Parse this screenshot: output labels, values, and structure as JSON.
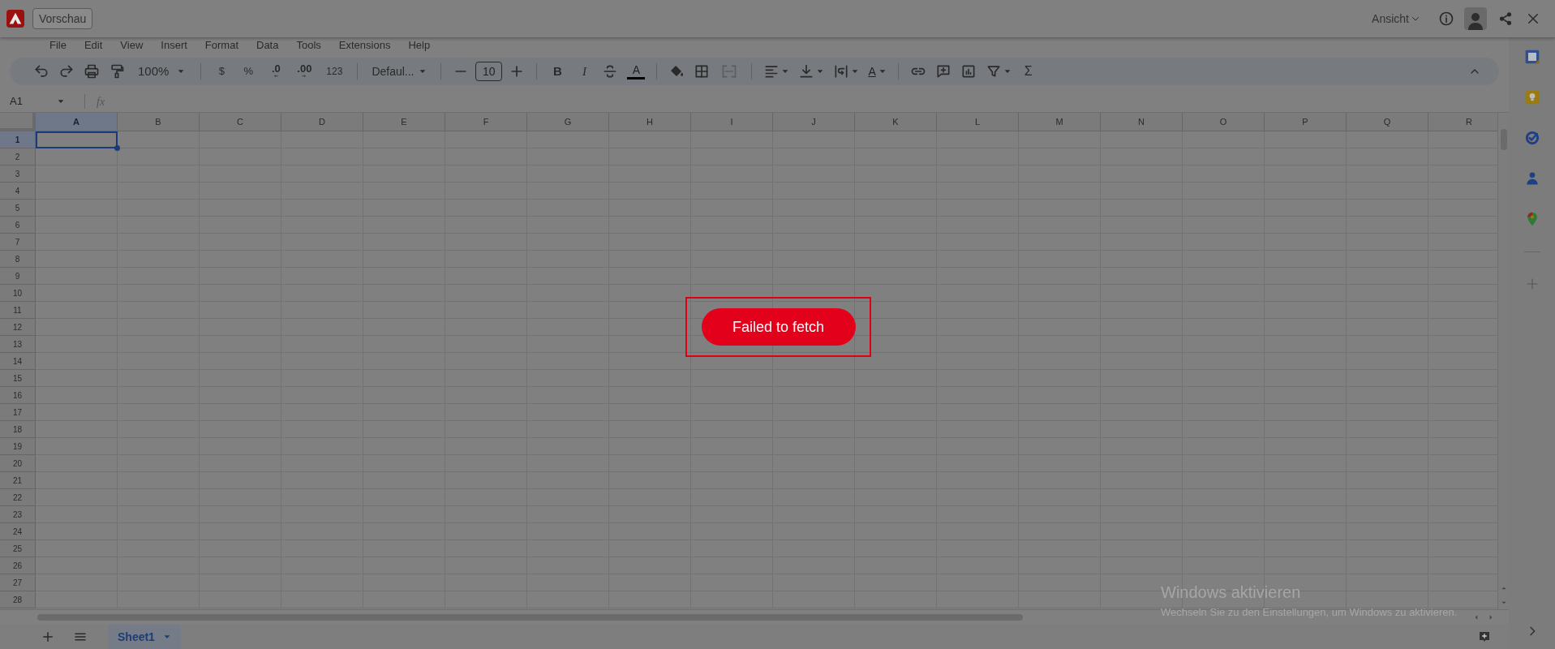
{
  "top_bar": {
    "preview_button": "Vorschau",
    "view_menu": "Ansicht"
  },
  "menu": [
    "File",
    "Edit",
    "View",
    "Insert",
    "Format",
    "Data",
    "Tools",
    "Extensions",
    "Help"
  ],
  "toolbar": {
    "zoom": "100%",
    "currency": "$",
    "percent": "%",
    "decrease_decimal": ".0",
    "increase_decimal": ".00",
    "more_formats": "123",
    "font": "Defaul...",
    "font_size": "10",
    "bold": "B",
    "italic": "I",
    "text_color": "A",
    "text_rotation": "A",
    "functions": "Σ"
  },
  "formula_bar": {
    "name_box": "A1",
    "fx_label": "fx"
  },
  "columns": [
    {
      "label": "A",
      "selected": true
    },
    {
      "label": "B",
      "selected": false
    },
    {
      "label": "C",
      "selected": false
    },
    {
      "label": "D",
      "selected": false
    },
    {
      "label": "E",
      "selected": false
    },
    {
      "label": "F",
      "selected": false
    },
    {
      "label": "G",
      "selected": false
    },
    {
      "label": "H",
      "selected": false
    },
    {
      "label": "I",
      "selected": false
    },
    {
      "label": "J",
      "selected": false
    },
    {
      "label": "K",
      "selected": false
    },
    {
      "label": "L",
      "selected": false
    },
    {
      "label": "M",
      "selected": false
    },
    {
      "label": "N",
      "selected": false
    },
    {
      "label": "O",
      "selected": false
    },
    {
      "label": "P",
      "selected": false
    },
    {
      "label": "Q",
      "selected": false
    },
    {
      "label": "R",
      "selected": false
    }
  ],
  "rows": [
    {
      "label": "1",
      "selected": true
    },
    {
      "label": "2",
      "selected": false
    },
    {
      "label": "3",
      "selected": false
    },
    {
      "label": "4",
      "selected": false
    },
    {
      "label": "5",
      "selected": false
    },
    {
      "label": "6",
      "selected": false
    },
    {
      "label": "7",
      "selected": false
    },
    {
      "label": "8",
      "selected": false
    },
    {
      "label": "9",
      "selected": false
    },
    {
      "label": "10",
      "selected": false
    },
    {
      "label": "11",
      "selected": false
    },
    {
      "label": "12",
      "selected": false
    },
    {
      "label": "13",
      "selected": false
    },
    {
      "label": "14",
      "selected": false
    },
    {
      "label": "15",
      "selected": false
    },
    {
      "label": "16",
      "selected": false
    },
    {
      "label": "17",
      "selected": false
    },
    {
      "label": "18",
      "selected": false
    },
    {
      "label": "19",
      "selected": false
    },
    {
      "label": "20",
      "selected": false
    },
    {
      "label": "21",
      "selected": false
    },
    {
      "label": "22",
      "selected": false
    },
    {
      "label": "23",
      "selected": false
    },
    {
      "label": "24",
      "selected": false
    },
    {
      "label": "25",
      "selected": false
    },
    {
      "label": "26",
      "selected": false
    },
    {
      "label": "27",
      "selected": false
    },
    {
      "label": "28",
      "selected": false
    }
  ],
  "sheet_tabs": [
    {
      "label": "Sheet1",
      "selected": true
    }
  ],
  "error_toast": {
    "message": "Failed to fetch"
  },
  "activation_notice": {
    "title": "Windows aktivieren",
    "body": "Wechseln Sie zu den Einstellungen, um Windows zu aktivieren."
  }
}
